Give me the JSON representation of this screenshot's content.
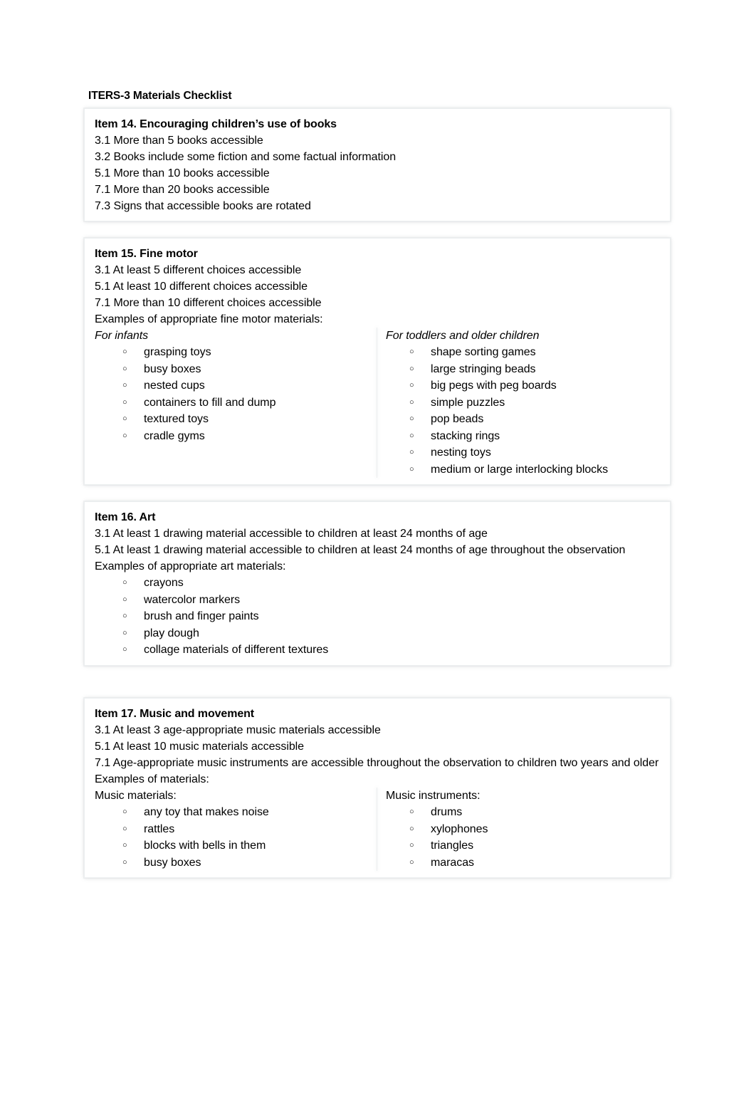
{
  "document": {
    "title": "ITERS-3 Materials Checklist"
  },
  "items": [
    {
      "id": "item14",
      "heading": "Item 14. Encouraging children’s use of books",
      "lines": [
        "3.1 More than 5 books accessible",
        "3.2 Books include some fiction and some factual information",
        "5.1 More than 10 books accessible",
        "7.1 More than 20 books accessible",
        "7.3 Signs that accessible books are rotated"
      ]
    },
    {
      "id": "item15",
      "heading": "Item 15. Fine motor",
      "lines": [
        "3.1 At least 5 different choices accessible",
        "5.1 At least 10 different choices accessible",
        "7.1 More than 10 different choices accessible",
        "Examples of appropriate fine motor materials:"
      ],
      "columns": {
        "left": {
          "subheading": "For infants",
          "bullets": [
            "grasping toys",
            "busy boxes",
            "nested cups",
            "containers to fill and dump",
            "textured toys",
            "cradle gyms"
          ]
        },
        "right": {
          "subheading": "For toddlers and older children",
          "bullets": [
            "shape sorting games",
            "large stringing beads",
            "big pegs with peg boards",
            "simple puzzles",
            "pop beads",
            "stacking rings",
            "nesting toys",
            "medium or large interlocking blocks"
          ]
        }
      }
    },
    {
      "id": "item16",
      "heading": "Item 16. Art",
      "lines": [
        "3.1 At least 1 drawing material accessible to children at least 24 months of age",
        "5.1 At least 1 drawing material accessible to children at least 24 months of age throughout the observation",
        "Examples of appropriate art materials:"
      ],
      "bullets": [
        "crayons",
        "watercolor markers",
        "brush and finger paints",
        "play dough",
        "collage materials of different textures"
      ]
    },
    {
      "id": "item17",
      "heading": "Item 17. Music and movement",
      "lines": [
        "3.1 At least 3 age-appropriate music materials accessible",
        "5.1 At least 10 music materials accessible",
        "7.1 Age-appropriate music instruments are accessible throughout the observation to children two years and older",
        "Examples of materials:"
      ],
      "columns": {
        "left": {
          "subheading": "Music materials:",
          "bullets": [
            "any toy that makes noise",
            "rattles",
            "blocks with bells in them",
            "busy boxes"
          ]
        },
        "right": {
          "subheading": "Music instruments:",
          "bullets": [
            "drums",
            "xylophones",
            "triangles",
            "maracas"
          ]
        }
      }
    }
  ],
  "style": {
    "bullet_glyph": "○",
    "text_color": "#000000",
    "page_background": "#ffffff",
    "box_border_color": "#eceff0"
  }
}
